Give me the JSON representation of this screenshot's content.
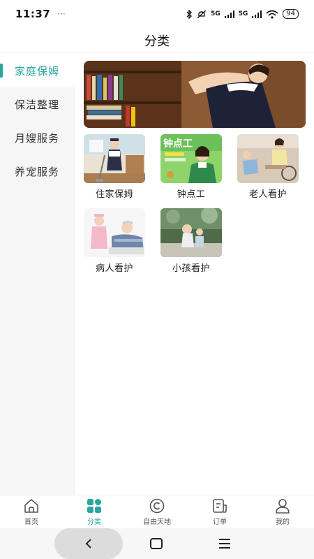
{
  "status": {
    "time": "11:37",
    "dots": "···",
    "signal1": "5G",
    "signal2": "5G",
    "battery": "94"
  },
  "header": {
    "title": "分类"
  },
  "sidebar": {
    "items": [
      {
        "label": "家庭保姆",
        "active": true
      },
      {
        "label": "保洁整理",
        "active": false
      },
      {
        "label": "月嫂服务",
        "active": false
      },
      {
        "label": "养宠服务",
        "active": false
      }
    ]
  },
  "services": [
    {
      "label": "住家保姆"
    },
    {
      "label": "钟点工",
      "overlay": "钟点工"
    },
    {
      "label": "老人看护"
    },
    {
      "label": "病人看护"
    },
    {
      "label": "小孩看护"
    }
  ],
  "tabbar": {
    "items": [
      {
        "label": "首页",
        "icon": "home-icon"
      },
      {
        "label": "分类",
        "icon": "category-grid-icon",
        "active": true
      },
      {
        "label": "自由天地",
        "icon": "copyright-c-icon"
      },
      {
        "label": "订单",
        "icon": "order-icon"
      },
      {
        "label": "我的",
        "icon": "person-icon"
      }
    ]
  },
  "navbar": {
    "back": "<"
  },
  "colors": {
    "accent": "#2aa6a0",
    "sidebar_bg": "#f6f6f6"
  }
}
